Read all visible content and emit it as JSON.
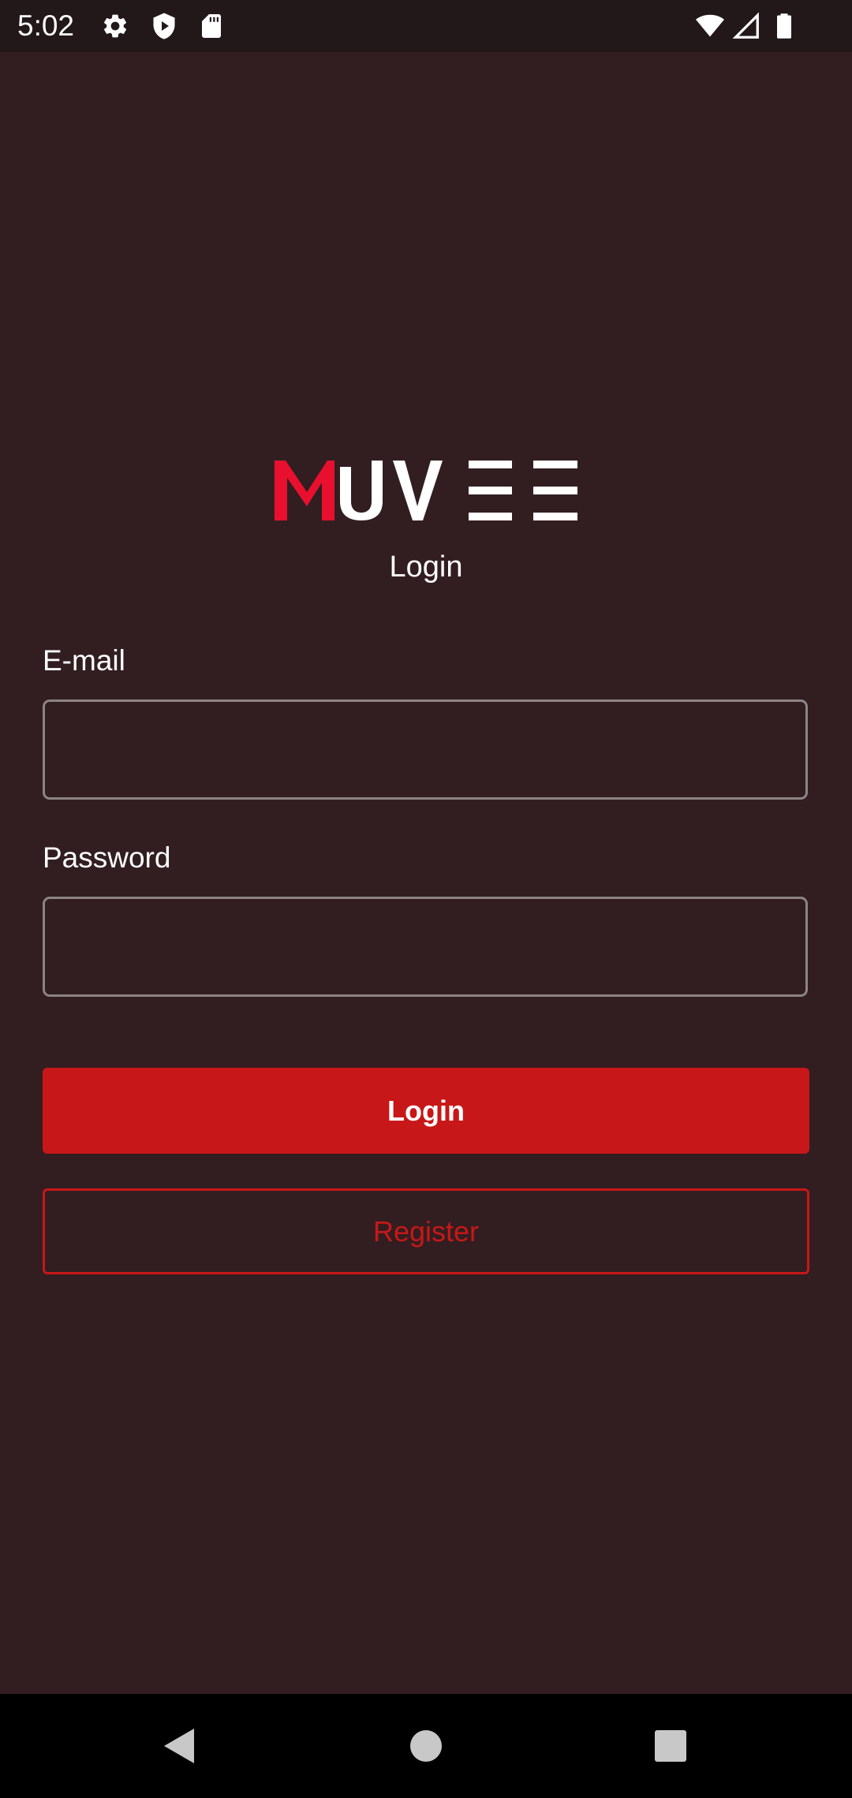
{
  "status_bar": {
    "time": "5:02",
    "icons": [
      "settings-icon",
      "shield-play-icon",
      "sd-card-icon",
      "wifi-icon",
      "cell-signal-icon",
      "battery-icon"
    ]
  },
  "brand": {
    "logo_text": "MUVEE",
    "accent_color": "#e8102e",
    "primary_color": "#c81718",
    "background_color": "#321e21"
  },
  "page": {
    "subtitle": "Login"
  },
  "form": {
    "email_label": "E-mail",
    "email_value": "",
    "email_placeholder": "",
    "password_label": "Password",
    "password_value": "",
    "password_placeholder": "",
    "login_label": "Login",
    "register_label": "Register"
  },
  "nav_bar": {
    "icons": [
      "back-icon",
      "home-icon",
      "recents-icon"
    ]
  }
}
